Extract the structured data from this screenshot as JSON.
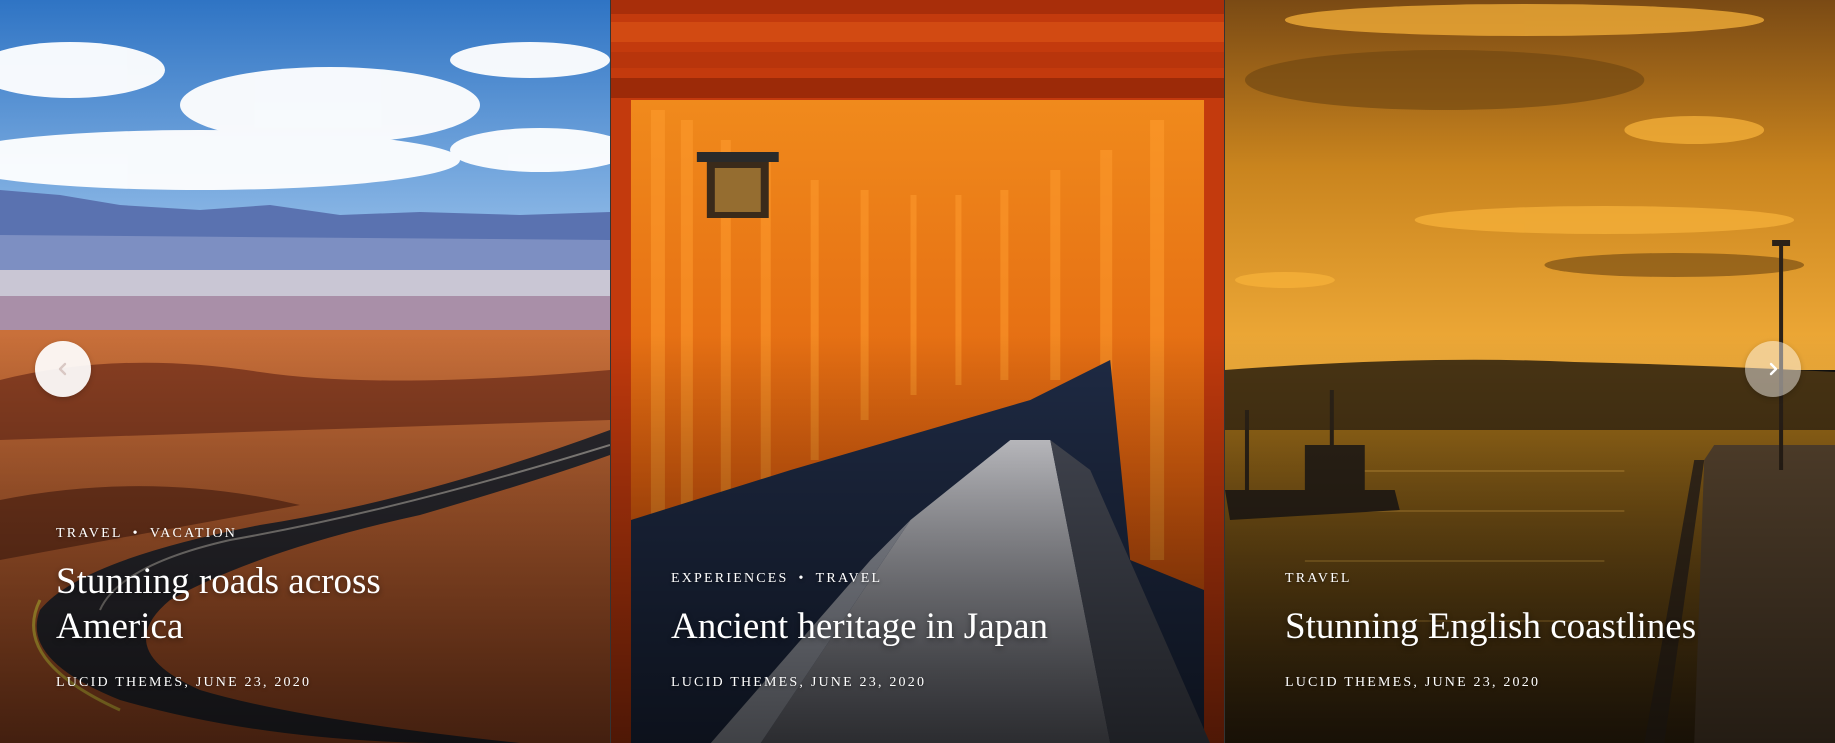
{
  "slides": [
    {
      "categories": [
        "Travel",
        "Vacation"
      ],
      "separator": "•",
      "title": "Stunning roads across America",
      "meta": "Lucid Themes, June 23, 2020",
      "scene": "desert-road"
    },
    {
      "categories": [
        "Experiences",
        "Travel"
      ],
      "separator": "•",
      "title": "Ancient heritage in Japan",
      "meta": "Lucid Themes, June 23, 2020",
      "scene": "torii-gates"
    },
    {
      "categories": [
        "Travel"
      ],
      "separator": "•",
      "title": "Stunning English coastlines",
      "meta": "Lucid Themes, June 23, 2020",
      "scene": "sunset-pier"
    }
  ],
  "nav": {
    "prev_icon": "chevron-left-icon",
    "next_icon": "chevron-right-icon"
  },
  "colors": {
    "nav_arrow": "#d9c8c4",
    "text": "#ffffff"
  }
}
